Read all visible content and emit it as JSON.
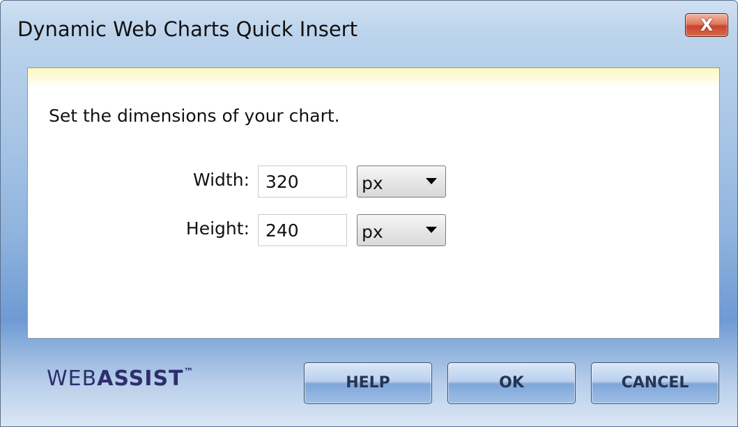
{
  "window": {
    "title": "Dynamic Web Charts Quick Insert",
    "close_label": "X"
  },
  "content": {
    "instruction": "Set the dimensions of your chart.",
    "width": {
      "label": "Width:",
      "value": "320",
      "unit": "px"
    },
    "height": {
      "label": "Height:",
      "value": "240",
      "unit": "px"
    }
  },
  "footer": {
    "logo_light": "WEB",
    "logo_bold": "ASSIST",
    "logo_tm": "™",
    "help_label": "HELP",
    "ok_label": "OK",
    "cancel_label": "CANCEL"
  }
}
